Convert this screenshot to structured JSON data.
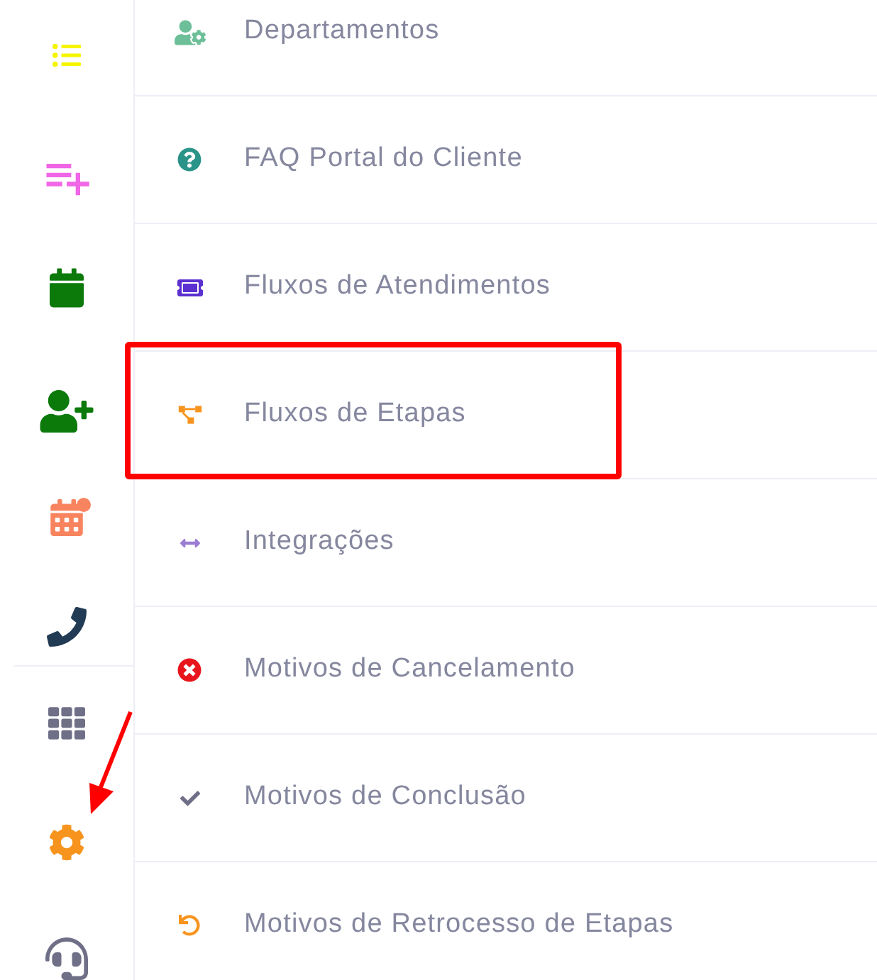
{
  "menu_items": [
    {
      "label": "Departamentos",
      "highlighted": false
    },
    {
      "label": "FAQ Portal do Cliente",
      "highlighted": false
    },
    {
      "label": "Fluxos de Atendimentos",
      "highlighted": false
    },
    {
      "label": "Fluxos de Etapas",
      "highlighted": true
    },
    {
      "label": "Integrações",
      "highlighted": false
    },
    {
      "label": "Motivos de Cancelamento",
      "highlighted": false
    },
    {
      "label": "Motivos de Conclusão",
      "highlighted": false
    },
    {
      "label": "Motivos de Retrocesso de Etapas",
      "highlighted": false
    }
  ]
}
